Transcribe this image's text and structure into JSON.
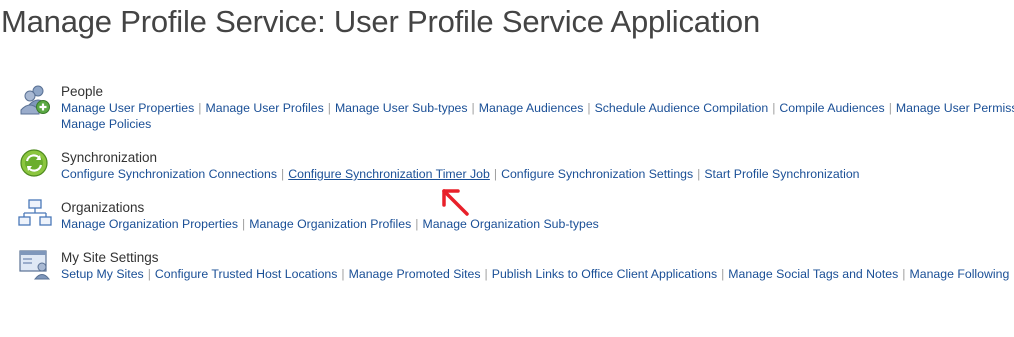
{
  "page": {
    "title": "Manage Profile Service: User Profile Service Application"
  },
  "sections": [
    {
      "heading": "People",
      "icon": "people-icon",
      "links": [
        "Manage User Properties",
        "Manage User Profiles",
        "Manage User Sub-types",
        "Manage Audiences",
        "Schedule Audience Compilation",
        "Compile Audiences",
        "Manage User Permissions",
        "Manage Policies"
      ]
    },
    {
      "heading": "Synchronization",
      "icon": "sync-icon",
      "links": [
        "Configure Synchronization Connections",
        "Configure Synchronization Timer Job",
        "Configure Synchronization Settings",
        "Start Profile Synchronization"
      ]
    },
    {
      "heading": "Organizations",
      "icon": "org-chart-icon",
      "links": [
        "Manage Organization Properties",
        "Manage Organization Profiles",
        "Manage Organization Sub-types"
      ]
    },
    {
      "heading": "My Site Settings",
      "icon": "my-site-icon",
      "links": [
        "Setup My Sites",
        "Configure Trusted Host Locations",
        "Manage Promoted Sites",
        "Publish Links to Office Client Applications",
        "Manage Social Tags and Notes",
        "Manage Following"
      ]
    }
  ],
  "colors": {
    "link": "#1a4f96",
    "title": "#444444",
    "separator": "#a0a0a0",
    "annotation_arrow": "#e8202a"
  }
}
